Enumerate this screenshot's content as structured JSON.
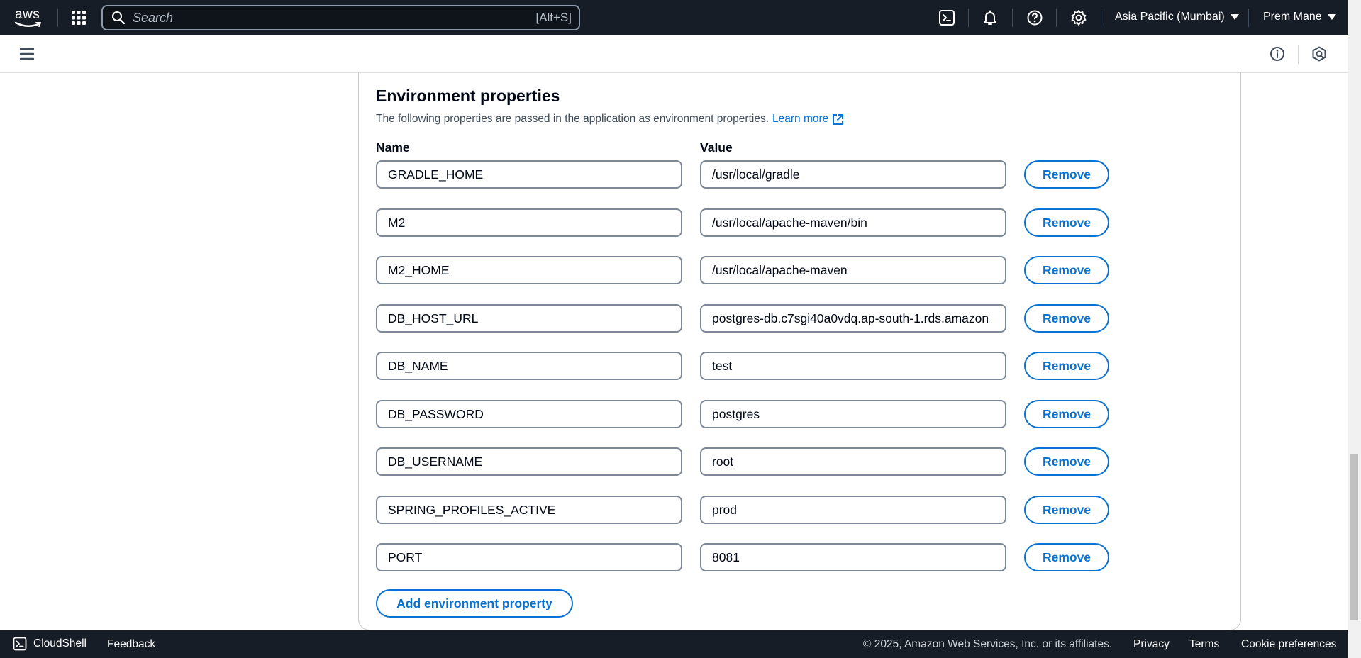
{
  "topnav": {
    "logo_text": "aws",
    "search_placeholder": "Search",
    "search_shortcut": "[Alt+S]",
    "region": "Asia Pacific (Mumbai)",
    "user": "Prem Mane",
    "icons": [
      "grid-icon",
      "search-icon",
      "cloudshell-icon",
      "bell-icon",
      "help-icon",
      "gear-icon"
    ]
  },
  "section": {
    "title": "Environment properties",
    "description": "The following properties are passed in the application as environment properties.",
    "learn_more": "Learn more",
    "name_label": "Name",
    "value_label": "Value",
    "remove_label": "Remove",
    "add_label": "Add environment property"
  },
  "properties": [
    {
      "name": "GRADLE_HOME",
      "value": "/usr/local/gradle"
    },
    {
      "name": "M2",
      "value": "/usr/local/apache-maven/bin"
    },
    {
      "name": "M2_HOME",
      "value": "/usr/local/apache-maven"
    },
    {
      "name": "DB_HOST_URL",
      "value": "postgres-db.c7sgi40a0vdq.ap-south-1.rds.amazon"
    },
    {
      "name": "DB_NAME",
      "value": "test"
    },
    {
      "name": "DB_PASSWORD",
      "value": "postgres"
    },
    {
      "name": "DB_USERNAME",
      "value": "root"
    },
    {
      "name": "SPRING_PROFILES_ACTIVE",
      "value": "prod"
    },
    {
      "name": "PORT",
      "value": "8081"
    }
  ],
  "footer": {
    "cloudshell": "CloudShell",
    "feedback": "Feedback",
    "copyright": "© 2025, Amazon Web Services, Inc. or its affiliates.",
    "privacy": "Privacy",
    "terms": "Terms",
    "cookie": "Cookie preferences"
  },
  "colors": {
    "nav_bg": "#161d26",
    "link": "#0972d3",
    "text": "#000716",
    "border": "#7d8998"
  }
}
